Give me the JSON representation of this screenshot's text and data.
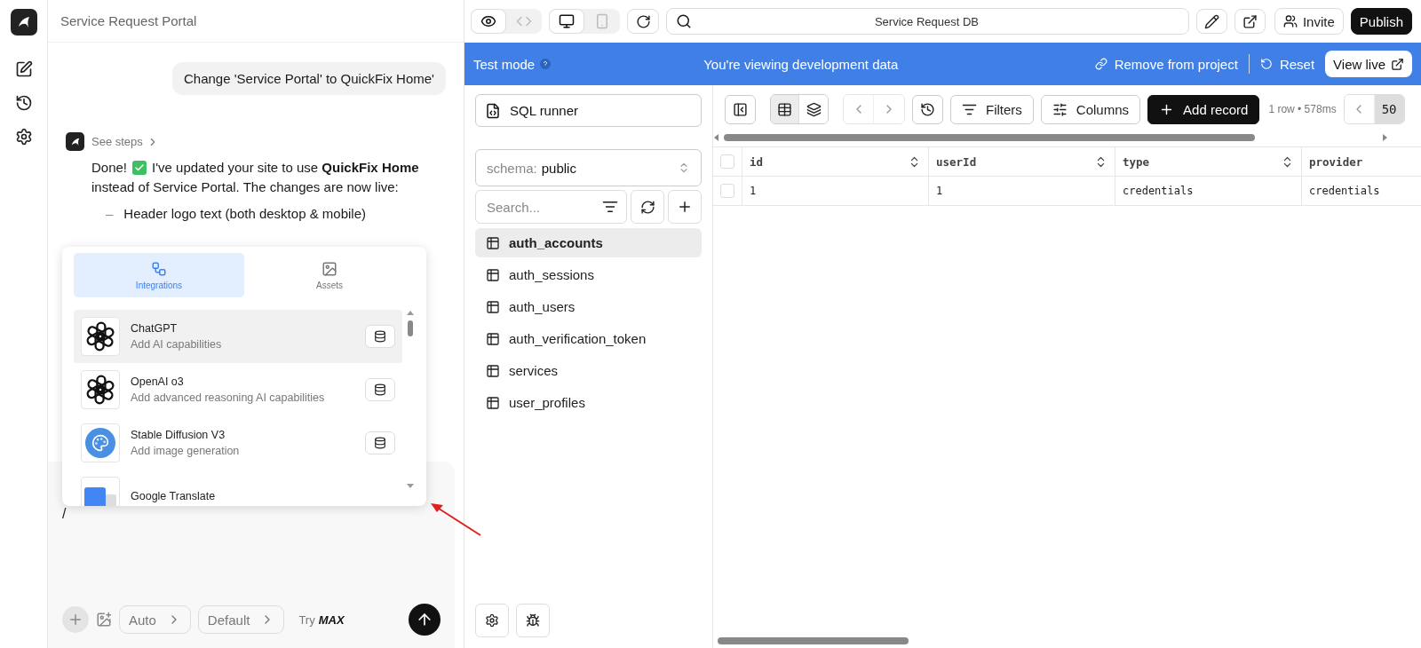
{
  "chat": {
    "title": "Service Request Portal",
    "user_message": "Change 'Service Portal' to QuickFix Home'",
    "see_steps": "See steps",
    "done": "Done!",
    "message_lines": [
      "I've updated your site to use **QuickFix Home**",
      "instead of Service Portal. The changes are now live:"
    ],
    "bullets": [
      {
        "marker": "–",
        "text": "Header logo text (both desktop & mobile)"
      }
    ]
  },
  "popup": {
    "tabs": [
      {
        "label": "Integrations",
        "kind": "integrations",
        "selected": true
      },
      {
        "label": "Assets",
        "kind": "assets",
        "selected": false
      }
    ],
    "items": [
      {
        "name": "ChatGPT",
        "description": "Add AI capabilities",
        "kind": "openai",
        "selected": true
      },
      {
        "name": "OpenAI o3",
        "description": "Add advanced reasoning AI capabilities",
        "kind": "openai",
        "selected": false
      },
      {
        "name": "Stable Diffusion V3",
        "description": "Add image generation",
        "kind": "palette",
        "selected": false
      },
      {
        "name": "Google Translate",
        "kind": "translate",
        "selected": false
      }
    ]
  },
  "composer": {
    "value": "/",
    "mode": "Auto",
    "model": "Default",
    "try_label": "Try",
    "max_label": "MAX"
  },
  "toolbar": {
    "view_modes": [
      {
        "kind": "preview",
        "selected": true
      },
      {
        "kind": "code",
        "selected": false
      }
    ],
    "devices": [
      {
        "kind": "desktop",
        "selected": true
      },
      {
        "kind": "mobile",
        "selected": false
      }
    ],
    "address": "Service Request DB",
    "invite": "Invite",
    "publish": "Publish"
  },
  "banner": {
    "mode": "Test mode",
    "message": "You're viewing development data",
    "remove": "Remove from project",
    "reset": "Reset",
    "view_live": "View live"
  },
  "db_sidebar": {
    "sql_runner": "SQL runner",
    "schema_label": "schema:",
    "schema_value": "public",
    "search_placeholder": "Search...",
    "tables": [
      {
        "name": "auth_accounts",
        "selected": true
      },
      {
        "name": "auth_sessions",
        "selected": false
      },
      {
        "name": "auth_users",
        "selected": false
      },
      {
        "name": "auth_verification_token",
        "selected": false
      },
      {
        "name": "services",
        "selected": false
      },
      {
        "name": "user_profiles",
        "selected": false
      }
    ]
  },
  "table": {
    "views": [
      {
        "kind": "grid",
        "selected": true
      },
      {
        "kind": "layers",
        "selected": false
      }
    ],
    "filters": "Filters",
    "columns_button": "Columns",
    "add_record": "Add record",
    "stats": "1 row • 578ms",
    "page_size": "50",
    "all_checked": false,
    "columns": [
      "id",
      "userId",
      "type",
      "provider"
    ],
    "rows": [
      {
        "checked": false,
        "cells": [
          "1",
          "1",
          "credentials",
          "credentials"
        ]
      }
    ]
  }
}
